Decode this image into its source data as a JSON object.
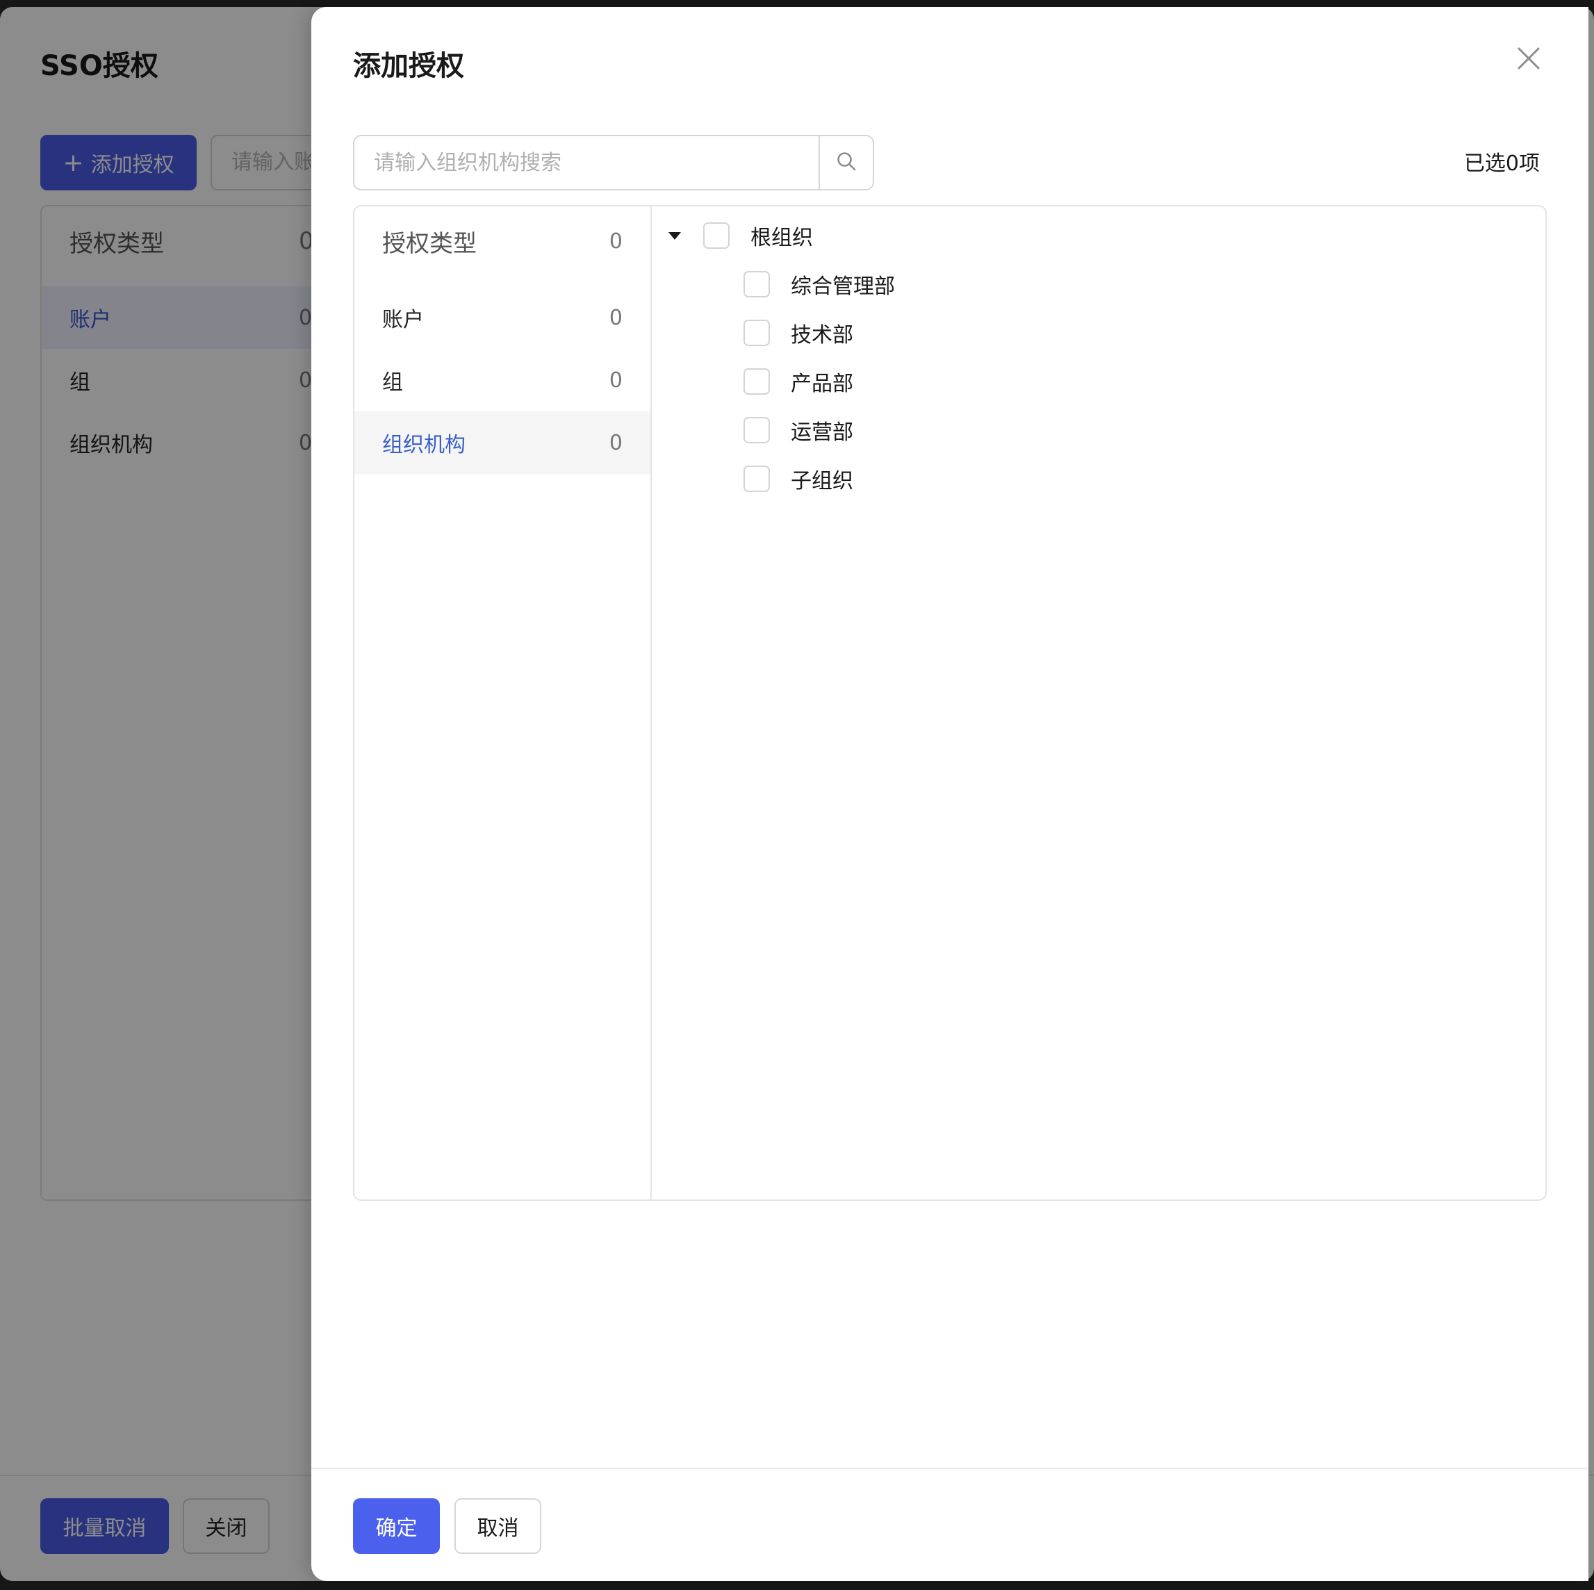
{
  "background_page": {
    "title": "SSO授权",
    "add_button_label": "添加授权",
    "search_placeholder": "请输入账",
    "type_panel": {
      "header": {
        "label": "授权类型",
        "count": "0"
      },
      "items": [
        {
          "label": "账户",
          "count": "0"
        },
        {
          "label": "组",
          "count": "0"
        },
        {
          "label": "组织机构",
          "count": "0"
        }
      ]
    },
    "batch_cancel_label": "批量取消",
    "close_label": "关闭"
  },
  "drawer": {
    "title": "添加授权",
    "search_placeholder": "请输入组织机构搜索",
    "selected_text": "已选0项",
    "type_panel": {
      "header": {
        "label": "授权类型",
        "count": "0"
      },
      "items": [
        {
          "label": "账户",
          "count": "0"
        },
        {
          "label": "组",
          "count": "0"
        },
        {
          "label": "组织机构",
          "count": "0"
        }
      ]
    },
    "tree": {
      "root": {
        "label": "根组织",
        "expanded": true,
        "checked": false
      },
      "children": [
        {
          "label": "综合管理部",
          "checked": false
        },
        {
          "label": "技术部",
          "checked": false
        },
        {
          "label": "产品部",
          "checked": false
        },
        {
          "label": "运营部",
          "checked": false
        },
        {
          "label": "子组织",
          "checked": false
        }
      ]
    },
    "confirm_label": "确定",
    "cancel_label": "取消"
  },
  "colors": {
    "primary": "#4b61ee",
    "active_text": "#3b5fc9"
  }
}
